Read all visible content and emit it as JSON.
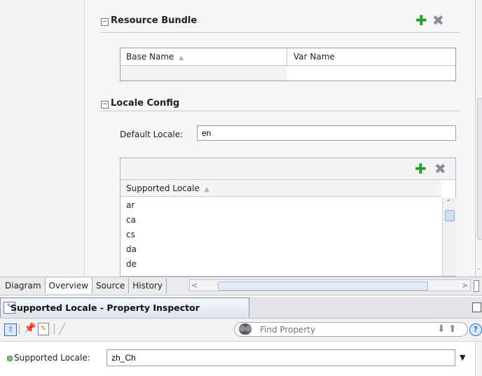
{
  "resource_bundle": {
    "title": "Resource Bundle",
    "toggle": "−",
    "columns": [
      "Base Name",
      "Var Name"
    ],
    "sort_indicator": "▲",
    "add_icon": "plus-icon",
    "delete_icon": "delete-icon"
  },
  "locale_config": {
    "title": "Locale Config",
    "toggle": "−",
    "default_locale_label": "Default Locale:",
    "default_locale_value": "en",
    "supported_locale_header": "Supported Locale",
    "sort_indicator": "▲",
    "locales": [
      "ar",
      "ca",
      "cs",
      "da",
      "de"
    ]
  },
  "editor_tabs": [
    "Diagram",
    "Overview",
    "Source",
    "History"
  ],
  "active_editor_tab": "Overview",
  "inspector": {
    "title": "Supported Locale - Property Inspector",
    "search_placeholder": "Find Property",
    "property_label": "Supported Locale:",
    "property_value": "zh_Ch"
  },
  "colors": {
    "add": "#2c9a2c",
    "delete": "#8d8d95",
    "accent": "#3a72c8"
  }
}
